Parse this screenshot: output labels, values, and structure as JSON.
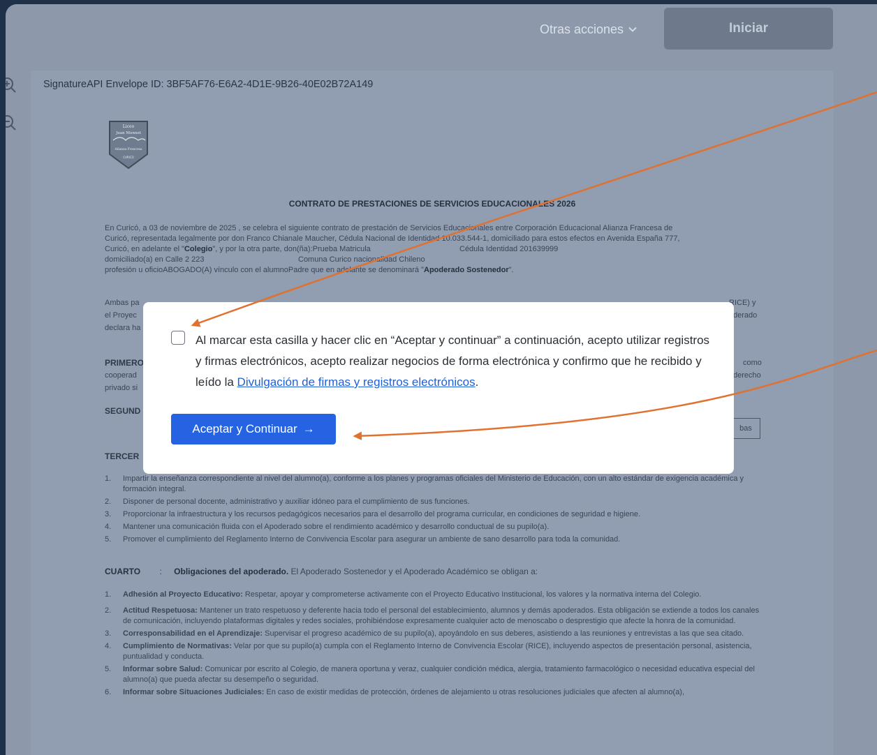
{
  "topbar": {
    "other_actions_label": "Otras acciones",
    "start_label": "Iniciar"
  },
  "document": {
    "envelope_label": "SignatureAPI Envelope ID: 3BF5AF76-E6A2-4D1E-9B26-40E02B72A149",
    "crest_text": [
      "Liceo",
      "Juan Monnet",
      "Alianza Francesa",
      "CURICO"
    ],
    "title": "CONTRATO DE PRESTACIONES DE SERVICIOS EDUCACIONALES 2026",
    "intro_lines": [
      "En Curicó, a 03 de noviembre de 2025 , se celebra el siguiente contrato de prestación de Servicios Educacionales entre Corporación Educacional Alianza Francesa de",
      "Curicó, representada legalmente por don Franco Chianale Maucher, Cédula Nacional de Identidad 10.033.544-1, domiciliado para estos efectos en Avenida España 777,"
    ],
    "intro_line3_pre": "Curicó, en adelante el \"",
    "intro_line3_bold": "Colegio",
    "intro_line3_post": "\", y por la otra parte, don(ña):Prueba Matricula",
    "intro_line3_id": "Cédula Identidad 201639999",
    "intro_line4_addr": "domiciliado(a) en Calle 2 223",
    "intro_line4_comuna": "Comuna Curico nacionalidad Chileno",
    "intro_line5_pre": "profesión u oficioABOGADO(A) vínculo con el alumnoPadre que en adelante se denominará \"",
    "intro_line5_bold": "Apoderado Sostenedor",
    "intro_line5_post": "\".",
    "partial_lines": {
      "ambas": "Ambas pa",
      "ambas_right": "RICE) y",
      "proyec": "el Proyec",
      "proyec_right": "derado",
      "declara": "declara ha",
      "primero": "PRIMERO",
      "primero_right": "como",
      "cooperad": "cooperad",
      "cooperad_right": "derecho",
      "privado": "privado si",
      "segund": "SEGUND",
      "segund_btn": "bas",
      "tercer": "TERCER"
    },
    "tercero_items": [
      {
        "num": "1.",
        "text": "Impartir la enseñanza correspondiente al nivel del alumno(a), conforme a los planes y programas oficiales del Ministerio de Educación, con un alto estándar de exigencia académica y formación integral."
      },
      {
        "num": "2.",
        "text": "Disponer de personal docente, administrativo y auxiliar idóneo para el cumplimiento de sus funciones."
      },
      {
        "num": "3.",
        "text": "Proporcionar la infraestructura y los recursos pedagógicos necesarios para el desarrollo del programa curricular, en condiciones de seguridad e higiene."
      },
      {
        "num": "4.",
        "text": "Mantener una comunicación fluida con el Apoderado sobre el rendimiento académico y desarrollo conductual de su pupilo(a)."
      },
      {
        "num": "5.",
        "text": "Promover el cumplimiento del Reglamento Interno de Convivencia Escolar para asegurar un ambiente de sano desarrollo para toda la comunidad."
      }
    ],
    "cuarto_label": "CUARTO",
    "cuarto_colon": ":",
    "cuarto_bold": "Obligaciones del apoderado.",
    "cuarto_text": "El Apoderado Sostenedor y el Apoderado Académico se obligan a:",
    "cuarto_items": [
      {
        "num": "1.",
        "bold": "Adhesión al Proyecto Educativo:",
        "text": "Respetar, apoyar y comprometerse activamente con el Proyecto Educativo Institucional, los valores y la normativa interna del Colegio."
      },
      {
        "num": "2.",
        "bold": "Actitud Respetuosa:",
        "text": "Mantener un trato respetuoso y deferente hacia todo el personal del establecimiento, alumnos y demás apoderados. Esta obligación se extiende a todos los canales de comunicación, incluyendo plataformas digitales y redes sociales, prohibiéndose expresamente cualquier acto de menoscabo o desprestigio que afecte la honra de la comunidad."
      },
      {
        "num": "3.",
        "bold": "Corresponsabilidad en el Aprendizaje:",
        "text": "Supervisar el progreso académico de su pupilo(a), apoyándolo en sus deberes, asistiendo a las reuniones y entrevistas a las que sea citado."
      },
      {
        "num": "4.",
        "bold": "Cumplimiento de Normativas:",
        "text": "Velar por que su pupilo(a) cumpla con el Reglamento Interno de Convivencia Escolar (RICE), incluyendo aspectos de presentación personal, asistencia, puntualidad y conducta."
      },
      {
        "num": "5.",
        "bold": "Informar sobre Salud:",
        "text": "Comunicar por escrito al Colegio, de manera oportuna y veraz, cualquier condición médica, alergia, tratamiento farmacológico o necesidad educativa especial del alumno(a) que pueda afectar su desempeño o seguridad."
      },
      {
        "num": "6.",
        "bold": "Informar sobre Situaciones Judiciales:",
        "text": "En caso de existir medidas de protección, órdenes de alejamiento u otras resoluciones judiciales que afecten al alumno(a),"
      }
    ]
  },
  "modal": {
    "consent_text": "Al marcar esta casilla y hacer clic en “Aceptar y continuar” a continuación, acepto utilizar registros y firmas electrónicos, acepto realizar negocios de forma electrónica y confirmo que he recibido y leído la ",
    "consent_link": "Divulgación de firmas y registros electrónicos",
    "consent_end": ".",
    "accept_label": "Aceptar y Continuar",
    "accept_arrow": "→"
  },
  "colors": {
    "backdrop": "#1e3148",
    "overlay": "#8d99aa",
    "primary_button": "#2563e3",
    "link": "#1f5fd6",
    "annotation_arrow": "#e0712f"
  }
}
